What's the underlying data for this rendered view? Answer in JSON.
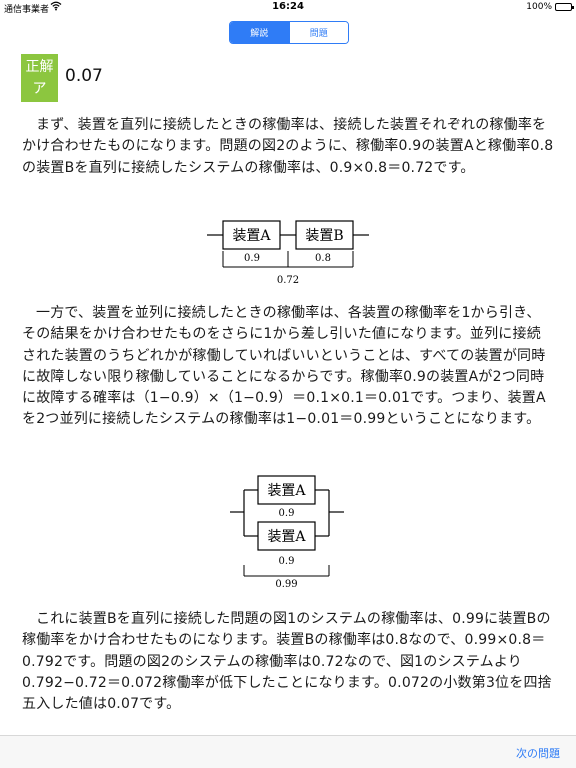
{
  "status": {
    "carrier": "通信事業者",
    "time": "16:24",
    "battery": "100%"
  },
  "tabs": [
    {
      "label": "解説",
      "active": true
    },
    {
      "label": "問題",
      "active": false
    }
  ],
  "answer": {
    "badge_line1": "正解",
    "badge_line2": "ア",
    "value": "0.07"
  },
  "paragraphs": [
    "まず、装置を直列に接続したときの稼働率は、接続した装置それぞれの稼働率をかけ合わせたものになります。問題の図2のように、稼働率0.9の装置Aと稼働率0.8の装置Bを直列に接続したシステムの稼働率は、0.9×0.8＝0.72です。",
    "一方で、装置を並列に接続したときの稼働率は、各装置の稼働率を1から引き、その結果をかけ合わせたものをさらに1から差し引いた値になります。並列に接続された装置のうちどれかが稼働していればいいということは、すべての装置が同時に故障しない限り稼働していることになるからです。稼働率0.9の装置Aが2つ同時に故障する確率は（1−0.9）×（1−0.9）＝0.1×0.1＝0.01です。つまり、装置Aを2つ並列に接続したシステムの稼働率は1−0.01＝0.99ということになります。",
    "これに装置Bを直列に接続した問題の図1のシステムの稼働率は、0.99に装置Bの稼働率をかけ合わせたものになります。装置Bの稼働率は0.8なので、0.99×0.8＝0.792です。問題の図2のシステムの稼働率は0.72なので、図1のシステムより0.792−0.72＝0.072稼働率が低下したことになります。0.072の小数第3位を四捨五入した値は0.07です。"
  ],
  "diagram_series": {
    "box_a": "装置A",
    "box_b": "装置B",
    "rate_a": "0.9",
    "rate_b": "0.8",
    "total": "0.72"
  },
  "diagram_parallel": {
    "box_top": "装置A",
    "box_bottom": "装置A",
    "rate_top": "0.9",
    "rate_bottom": "0.9",
    "total": "0.99"
  },
  "bottom": {
    "next_label": "次の問題"
  }
}
